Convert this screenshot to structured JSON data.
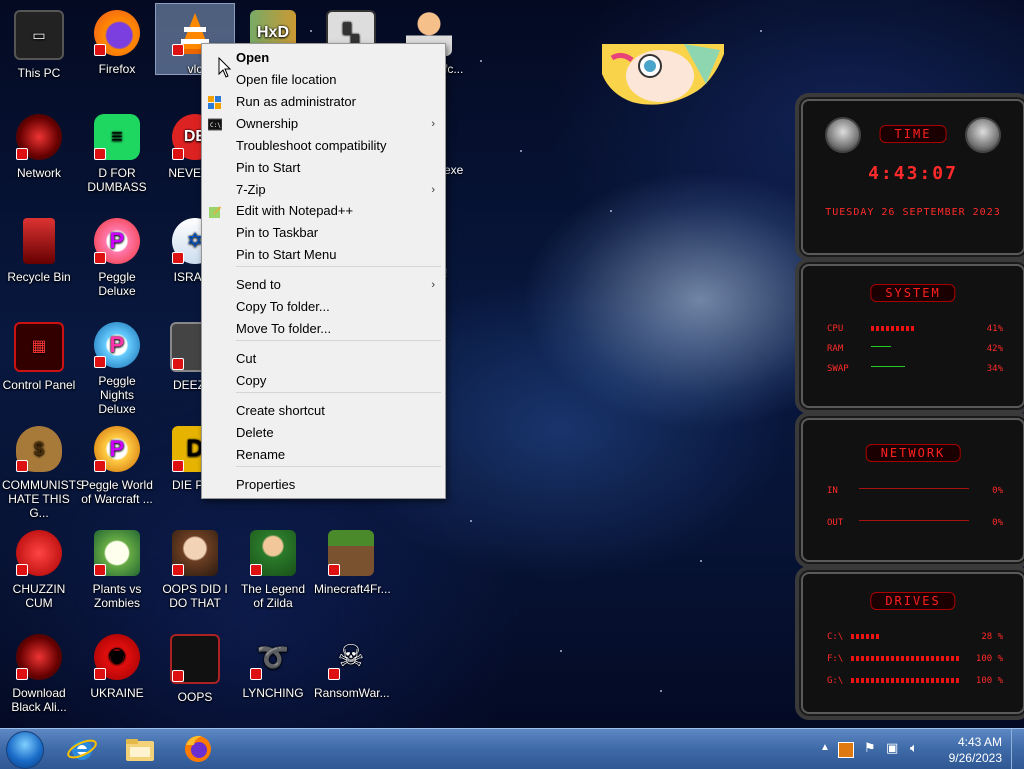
{
  "desktop_icons": [
    {
      "label": "This PC"
    },
    {
      "label": "Firefox"
    },
    {
      "label": "vlc"
    },
    {
      "label": ""
    },
    {
      "label": ""
    },
    {
      "label": ""
    },
    {
      "label": "Network"
    },
    {
      "label": "D FOR DUMBASS"
    },
    {
      "label": "NEVER U"
    },
    {
      "label": "Recycle Bin"
    },
    {
      "label": "Peggle Deluxe"
    },
    {
      "label": "ISRAEL"
    },
    {
      "label": "Control Panel"
    },
    {
      "label": "Peggle Nights Deluxe"
    },
    {
      "label": "DEEZ N"
    },
    {
      "label": "COMMUNISTS HATE THIS G..."
    },
    {
      "label": "Peggle World of Warcraft ..."
    },
    {
      "label": "DIE PLE"
    },
    {
      "label": "CHUZZIN CUM"
    },
    {
      "label": "Plants vs Zombies"
    },
    {
      "label": "OOPS DID I DO THAT"
    },
    {
      "label": "The Legend of Zilda"
    },
    {
      "label": "Minecraft4Fr..."
    },
    {
      "label": "Download Black Ali..."
    },
    {
      "label": "UKRAINE"
    },
    {
      "label": "OOPS"
    },
    {
      "label": "LYNCHING"
    },
    {
      "label": "RansomWar..."
    }
  ],
  "partial_labels": {
    "fc": "fc...",
    "exe": "exe",
    "bang": "!"
  },
  "context_menu": {
    "items": [
      {
        "label": "Open",
        "bold": true
      },
      {
        "label": "Open file location"
      },
      {
        "label": "Run as administrator",
        "icon": "shield-icon"
      },
      {
        "label": "Ownership",
        "icon": "console-icon",
        "submenu": true
      },
      {
        "label": "Troubleshoot compatibility"
      },
      {
        "label": "Pin to Start"
      },
      {
        "label": "7-Zip",
        "submenu": true
      },
      {
        "label": "Edit with Notepad++",
        "icon": "notepad-icon"
      },
      {
        "label": "Pin to Taskbar"
      },
      {
        "label": "Pin to Start Menu"
      },
      {
        "label": "Send to",
        "submenu": true
      },
      {
        "label": "Copy To folder..."
      },
      {
        "label": "Move To folder..."
      },
      {
        "label": "Cut"
      },
      {
        "label": "Copy"
      },
      {
        "label": "Create shortcut"
      },
      {
        "label": "Delete"
      },
      {
        "label": "Rename"
      },
      {
        "label": "Properties"
      }
    ],
    "submenu_arrow": "›"
  },
  "widgets": {
    "time": {
      "header": "TIME",
      "clock": "4:43:07",
      "date": "TUESDAY 26 SEPTEMBER 2023"
    },
    "system": {
      "header": "SYSTEM",
      "rows": [
        {
          "label": "CPU",
          "value": "41%"
        },
        {
          "label": "RAM",
          "value": "42%"
        },
        {
          "label": "SWAP",
          "value": "34%"
        }
      ]
    },
    "network": {
      "header": "NETWORK",
      "rows": [
        {
          "label": "IN",
          "value": "0%"
        },
        {
          "label": "OUT",
          "value": "0%"
        }
      ]
    },
    "drives": {
      "header": "DRIVES",
      "rows": [
        {
          "label": "C:\\",
          "value": "28 %"
        },
        {
          "label": "F:\\",
          "value": "100 %"
        },
        {
          "label": "G:\\",
          "value": "100 %"
        }
      ]
    }
  },
  "taskbar": {
    "apps": [
      {
        "name": "internet-explorer-icon"
      },
      {
        "name": "file-explorer-icon"
      },
      {
        "name": "firefox-icon"
      }
    ],
    "tray": {
      "time": "4:43 AM",
      "date": "9/26/2023"
    }
  },
  "colors": {
    "widget_red": "#ff2a2a",
    "taskbar_top": "#5d88c4",
    "taskbar_bottom": "#2f5893",
    "menu_bg": "#f0f0f0"
  }
}
